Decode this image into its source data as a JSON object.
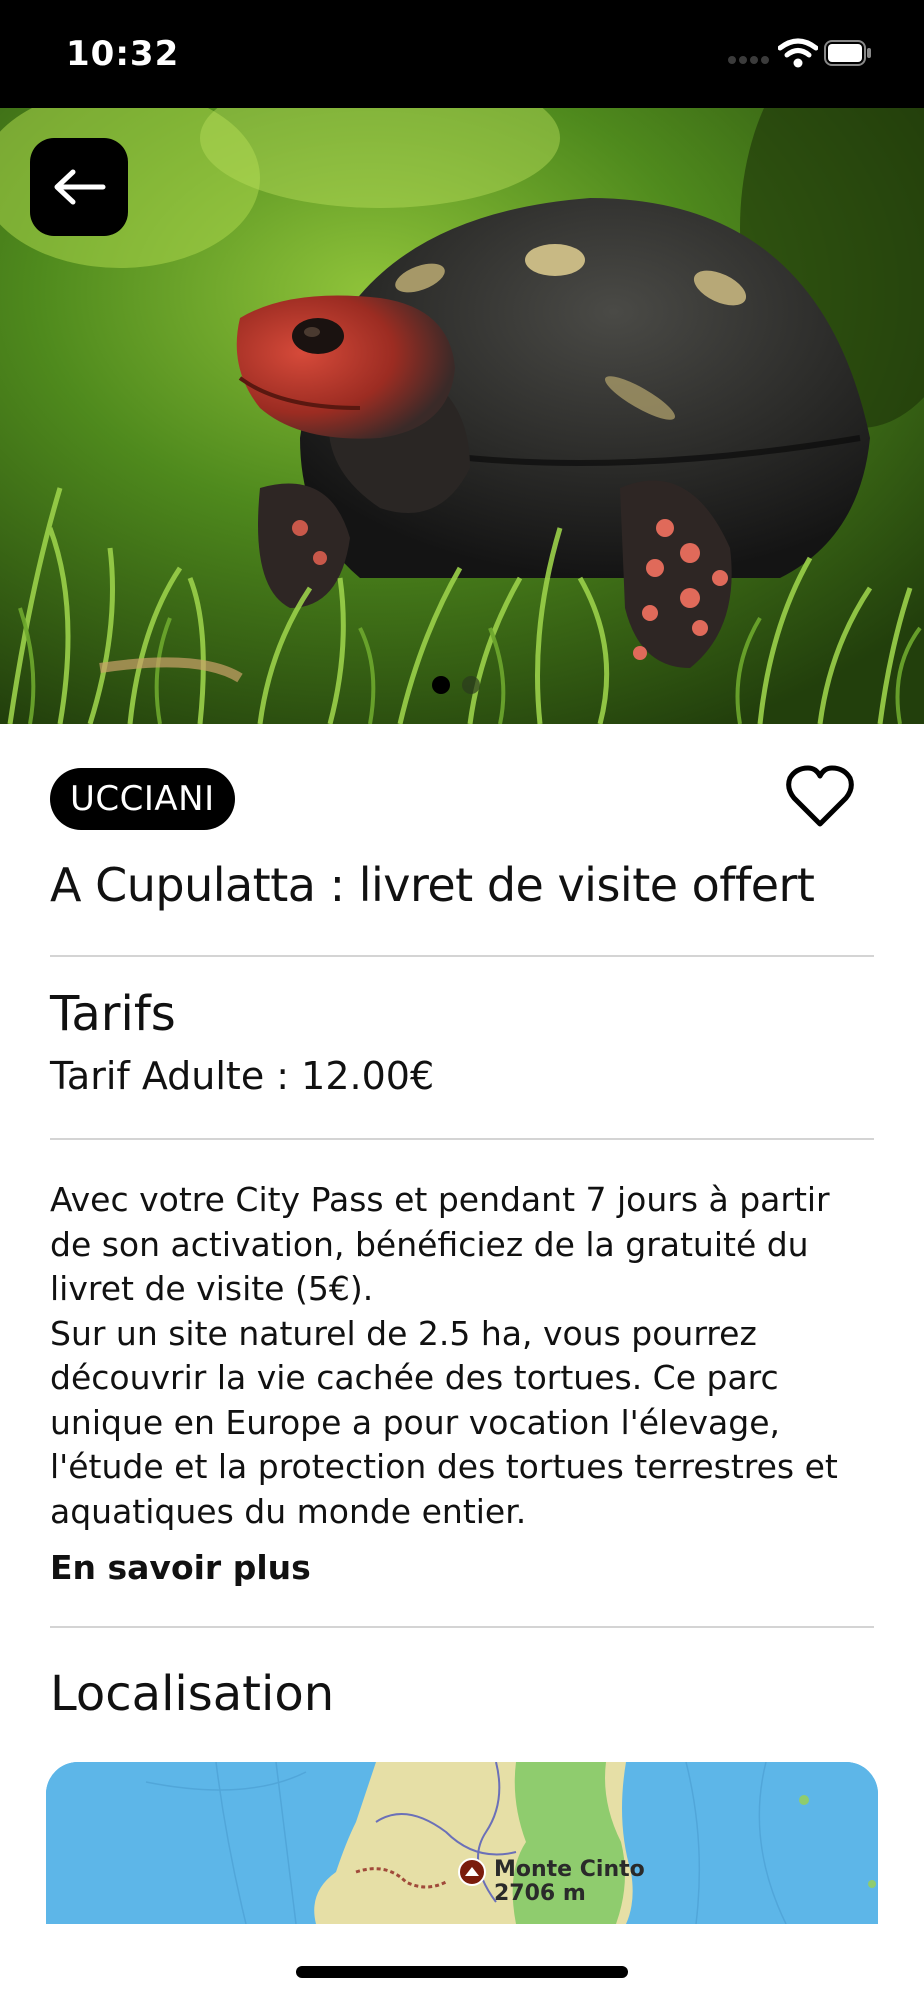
{
  "status_bar": {
    "time": "10:32"
  },
  "hero": {
    "image_subject": "red-footed-tortoise-in-grass",
    "slide_count": 2,
    "active_slide": 1
  },
  "tag": "UCCIANI",
  "title": "A Cupulatta : livret de visite offert",
  "tarifs": {
    "heading": "Tarifs",
    "price_line": "Tarif Adulte : 12.00€"
  },
  "description": {
    "paragraph1": "Avec votre City Pass et pendant 7 jours à partir de son activation, bénéficiez de la gratuité du livret de visite (5€).",
    "paragraph2": "Sur un site naturel de 2.5 ha, vous pourrez découvrir la vie cachée des tortues. Ce parc unique en Europe a pour vocation l'élevage, l'étude et la protection des tortues terrestres et aquatiques du monde entier.",
    "more_label": "En savoir plus"
  },
  "localisation": {
    "heading": "Localisation",
    "map_place": "Monte Cinto",
    "map_elevation": "2706 m"
  },
  "colors": {
    "sea": "#5db6e8",
    "land": "#e6dfa6",
    "forest": "#8fcc6e",
    "accent": "#000000"
  }
}
